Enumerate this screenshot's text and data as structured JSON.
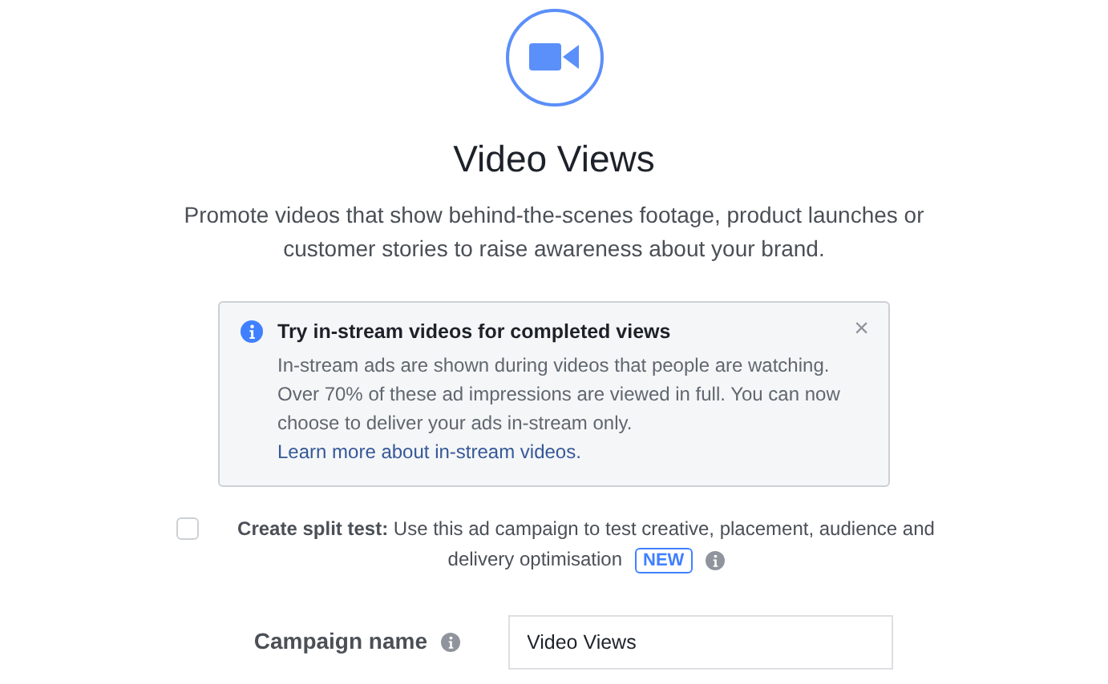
{
  "header": {
    "title": "Video Views",
    "description": "Promote videos that show behind-the-scenes footage, product launches or customer stories to raise awareness about your brand."
  },
  "notice": {
    "title": "Try in-stream videos for completed views",
    "body": "In-stream ads are shown during videos that people are watching. Over 70% of these ad impressions are viewed in full. You can now choose to deliver your ads in-stream only.",
    "link": "Learn more about in-stream videos.",
    "close": "×"
  },
  "split_test": {
    "checked": false,
    "lines": [
      "**Create split test:** Use this ad campaign to test creative, placement, audience and",
      "delivery optimisation"
    ],
    "badge": "NEW"
  },
  "campaign_name": {
    "label": "Campaign name",
    "value": "Video Views"
  }
}
